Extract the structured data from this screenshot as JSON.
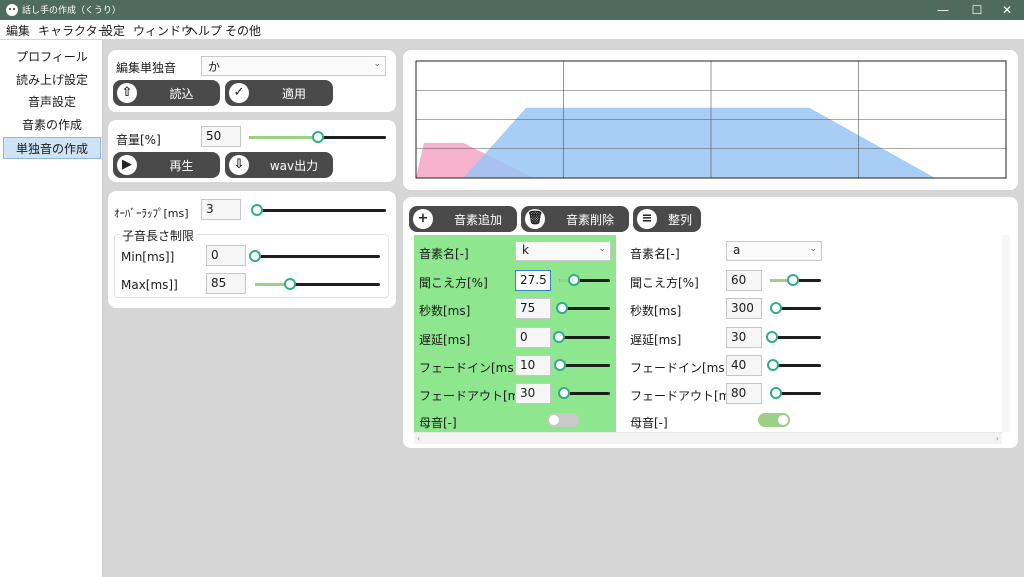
{
  "window": {
    "title": "話し手の作成（くうり）",
    "minimize": "—",
    "maximize": "☐",
    "close": "✕"
  },
  "menu": [
    "編集",
    "キャラクター",
    "設定",
    "ウィンドウ",
    "ヘルプ",
    "その他"
  ],
  "sidebar": {
    "items": [
      "プロフィール",
      "読み上げ設定",
      "音声設定",
      "音素の作成",
      "単独音の作成"
    ],
    "active_index": 4
  },
  "edit_panel": {
    "label": "編集単独音",
    "selected": "か",
    "load_button": "読込",
    "apply_button": "適用"
  },
  "volume_panel": {
    "label": "音量[%]",
    "value": "50",
    "slider": {
      "min": 0,
      "max": 100,
      "value": 50
    },
    "play_button": "再生",
    "export_button": "wav出力"
  },
  "overlap_panel": {
    "overlap_label": "ｵｰﾊﾞｰﾗｯﾌﾟ[ms]",
    "overlap_value": "3",
    "overlap_slider": {
      "min": 0,
      "max": 100,
      "value": 3
    },
    "group_title": "子音長さ制限",
    "min_label": "Min[ms]]",
    "min_value": "0",
    "min_slider": {
      "min": 0,
      "max": 300,
      "value": 0
    },
    "max_label": "Max[ms]]",
    "max_value": "85",
    "max_slider": {
      "min": 0,
      "max": 300,
      "value": 85
    }
  },
  "phoneme_toolbar": {
    "add_button": "音素追加",
    "delete_button": "音素削除",
    "arrange_button": "整列"
  },
  "phonemes": [
    {
      "name_label": "音素名[-]",
      "name_value": "k",
      "audibility_label": "聞こえ方[%]",
      "audibility_value": "27.5",
      "audibility_slider": 0.3,
      "seconds_label": "秒数[ms]",
      "seconds_value": "75",
      "seconds_slider": 0.05,
      "delay_label": "遅延[ms]",
      "delay_value": "0",
      "delay_slider": 0.0,
      "fadein_label": "フェードイン[ms]",
      "fadein_value": "10",
      "fadein_slider": 0.02,
      "fadeout_label": "フェードアウト[ms]",
      "fadeout_value": "30",
      "fadeout_slider": 0.05,
      "vowel_label": "母音[-]",
      "vowel_on": false,
      "highlight": "#8ee68e"
    },
    {
      "name_label": "音素名[-]",
      "name_value": "a",
      "audibility_label": "聞こえ方[%]",
      "audibility_value": "60",
      "audibility_slider": 0.45,
      "seconds_label": "秒数[ms]",
      "seconds_value": "300",
      "seconds_slider": 0.12,
      "delay_label": "遅延[ms]",
      "delay_value": "30",
      "delay_slider": 0.04,
      "fadein_label": "フェードイン[ms]",
      "fadein_value": "40",
      "fadein_slider": 0.05,
      "fadeout_label": "フェードアウト[ms]",
      "fadeout_value": "80",
      "fadeout_slider": 0.11,
      "vowel_label": "母音[-]",
      "vowel_on": true,
      "highlight": null
    }
  ],
  "colors": {
    "title_bar": "#4f6b60",
    "button_dark": "#4a4a4a",
    "slider_fill": "#9ccf87",
    "slider_thumb": "#2fae88",
    "highlight": "#8ee68e",
    "sidebar_active": "#cfe3f7"
  },
  "chart_data": {
    "type": "area",
    "x_range": [
      0,
      375
    ],
    "y_range": [
      0,
      100
    ],
    "grid": true,
    "series": [
      {
        "color": "#f4a3c4",
        "points": [
          [
            0,
            0
          ],
          [
            5,
            30
          ],
          [
            30,
            30
          ],
          [
            75,
            0
          ]
        ]
      },
      {
        "color": "#99c6f3",
        "points": [
          [
            30,
            0
          ],
          [
            70,
            60
          ],
          [
            250,
            60
          ],
          [
            330,
            0
          ]
        ]
      }
    ]
  }
}
